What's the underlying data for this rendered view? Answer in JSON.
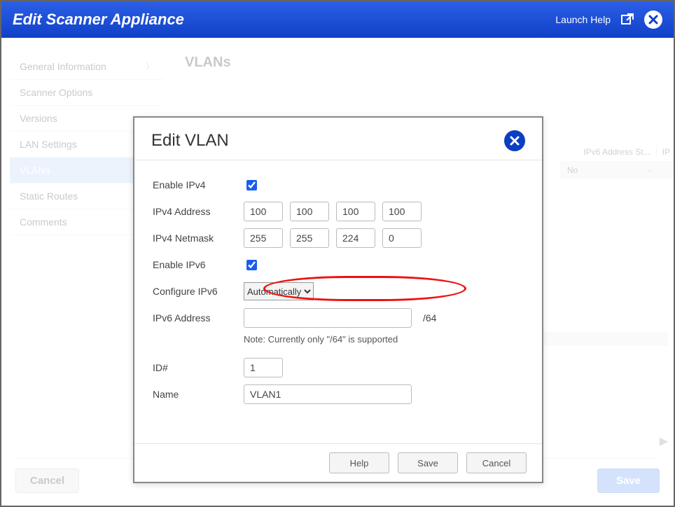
{
  "header": {
    "title": "Edit Scanner Appliance",
    "help": "Launch Help"
  },
  "sidebar": {
    "items": [
      {
        "label": "General Information"
      },
      {
        "label": "Scanner Options"
      },
      {
        "label": "Versions"
      },
      {
        "label": "LAN Settings"
      },
      {
        "label": "VLANs"
      },
      {
        "label": "Static Routes"
      },
      {
        "label": "Comments"
      }
    ]
  },
  "main": {
    "title": "VLANs",
    "bg_table": {
      "h1": "IPv6 Address St...",
      "h2": "IP",
      "r1": "No",
      "r2": "-"
    },
    "cancel": "Cancel",
    "save": "Save"
  },
  "modal": {
    "title": "Edit VLAN",
    "labels": {
      "enable_ipv4": "Enable IPv4",
      "ipv4_addr": "IPv4 Address",
      "ipv4_mask": "IPv4 Netmask",
      "enable_ipv6": "Enable IPv6",
      "config_ipv6": "Configure IPv6",
      "ipv6_addr": "IPv6 Address",
      "id": "ID#",
      "name": "Name"
    },
    "values": {
      "enable_ipv4": true,
      "ipv4_addr": [
        "100",
        "100",
        "100",
        "100"
      ],
      "ipv4_mask": [
        "255",
        "255",
        "224",
        "0"
      ],
      "enable_ipv6": true,
      "config_ipv6": "Automatically",
      "ipv6_addr": "",
      "ipv6_suffix": "/64",
      "note": "Note: Currently only \"/64\" is supported",
      "id": "1",
      "name": "VLAN1"
    },
    "buttons": {
      "help": "Help",
      "save": "Save",
      "cancel": "Cancel"
    }
  }
}
